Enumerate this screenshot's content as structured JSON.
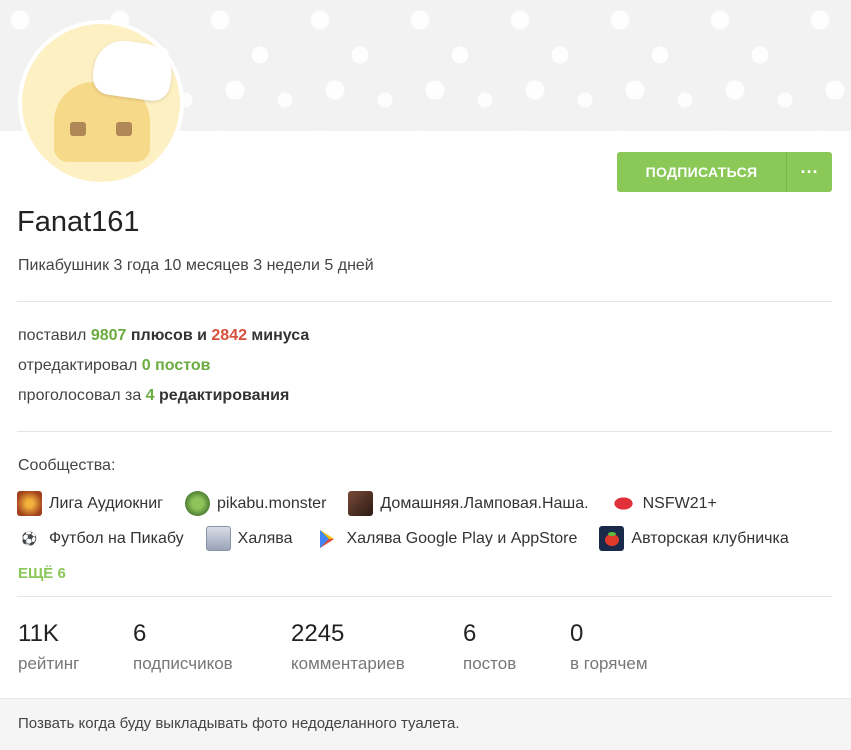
{
  "profile": {
    "username": "Fanat161",
    "tenure": "Пикабушник 3 года 10 месяцев 3 недели 5 дней",
    "subscribe_label": "ПОДПИСАТЬСЯ",
    "more_label": "···"
  },
  "activity": {
    "line1": {
      "prefix": "поставил ",
      "pluses": "9807",
      "middle": " плюсов и ",
      "minuses": "2842",
      "suffix": " минуса"
    },
    "line2": {
      "prefix": "отредактировал ",
      "value": "0 постов"
    },
    "line3": {
      "prefix": "проголосовал за ",
      "count": "4",
      "suffix": " редактирования"
    }
  },
  "communities": {
    "title": "Сообщества:",
    "row1": [
      {
        "name": "Лига Аудиокниг",
        "icon": "audiobook-icon",
        "color": "#c8632a"
      },
      {
        "name": "pikabu.monster",
        "icon": "monster-icon",
        "color": "#5a8a3c"
      },
      {
        "name": "Домашняя.Ламповая.Наша.",
        "icon": "home-icon",
        "color": "#5a3a2a"
      },
      {
        "name": "NSFW21+",
        "icon": "lips-icon",
        "color": "#d22c2c"
      }
    ],
    "row2": [
      {
        "name": "Футбол на Пикабу",
        "icon": "football-icon",
        "color": "#e7e7e7"
      },
      {
        "name": "Халява",
        "icon": "freebie-icon",
        "color": "#8a94a8"
      },
      {
        "name": "Халява Google Play и AppStore",
        "icon": "play-store-icon",
        "color": "#ffffff"
      },
      {
        "name": "Авторская клубничка",
        "icon": "strawberry-icon",
        "color": "#1b2a4a"
      }
    ],
    "more_label": "ЕЩЁ 6"
  },
  "stats": [
    {
      "value": "11K",
      "label": "рейтинг"
    },
    {
      "value": "6",
      "label": "подписчиков"
    },
    {
      "value": "2245",
      "label": "комментариев"
    },
    {
      "value": "6",
      "label": "постов"
    },
    {
      "value": "0",
      "label": "в горячем"
    }
  ],
  "footer": {
    "note": "Позвать когда буду выкладывать фото недоделанного туалета."
  },
  "colors": {
    "accent": "#8ac858",
    "plus": "#6bac3f",
    "minus": "#d7503c"
  }
}
